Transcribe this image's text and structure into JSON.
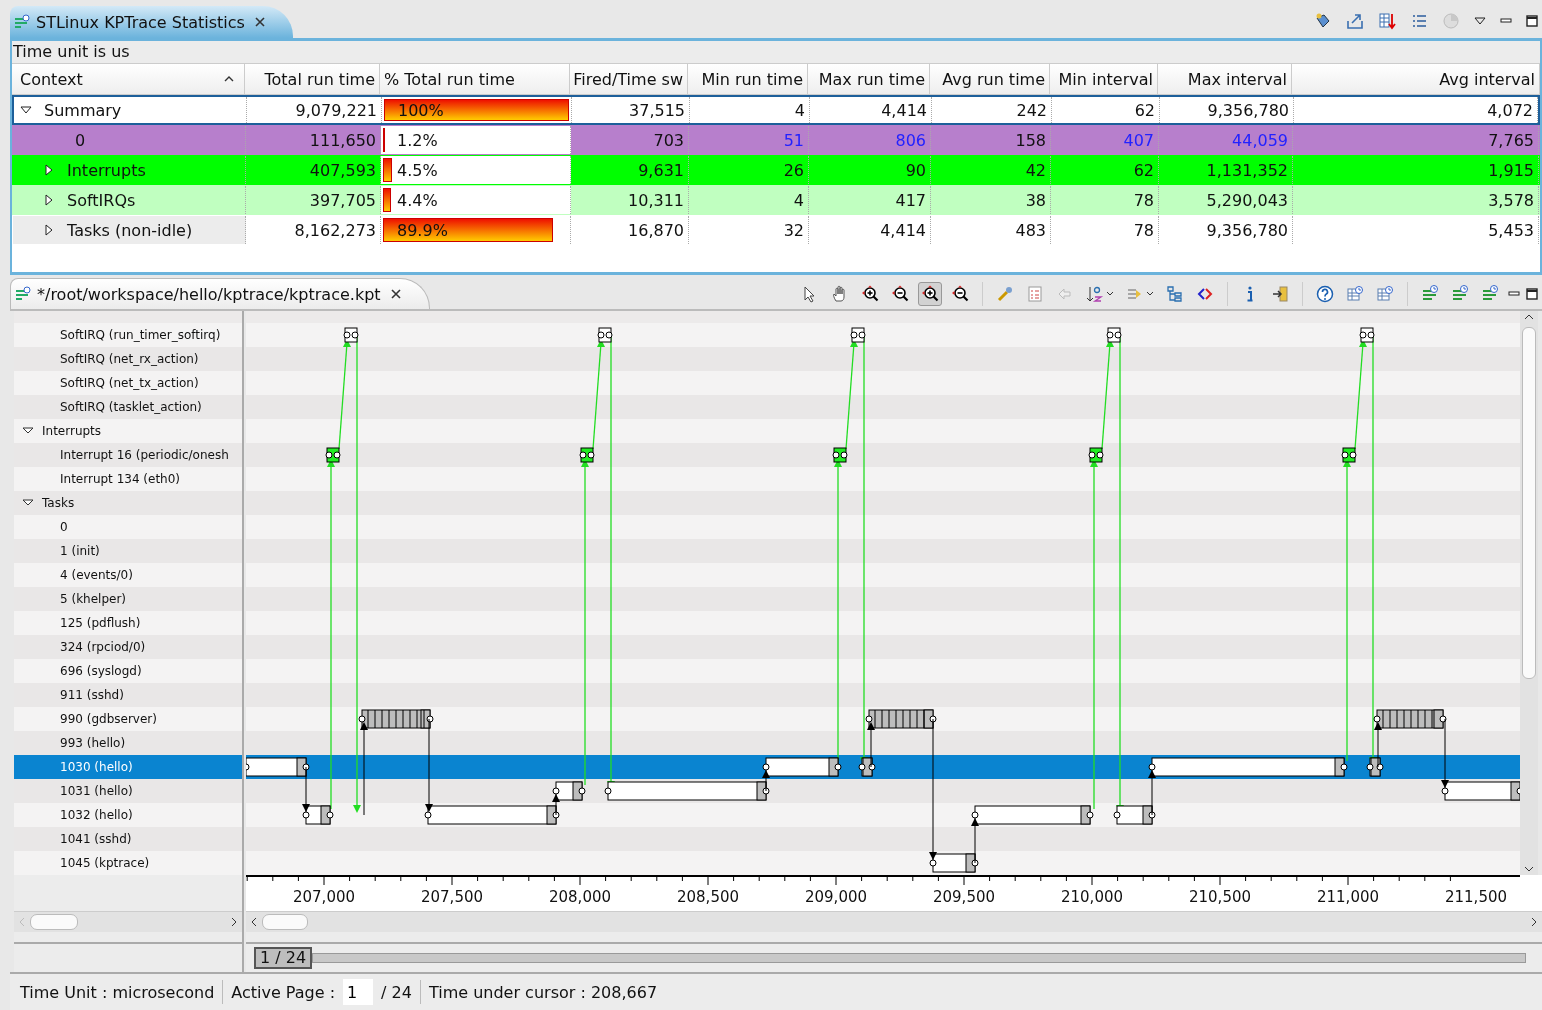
{
  "stats_view": {
    "tab": {
      "title": "STLinux KPTrace Statistics",
      "selected": true
    },
    "info": "Time unit is us",
    "columns": [
      {
        "label": "Context",
        "sorted": true
      },
      {
        "label": "Total run time",
        "sorted": false
      },
      {
        "label": "% Total run time",
        "sorted": false
      },
      {
        "label": "Fired/Time sw",
        "sorted": false
      },
      {
        "label": "Min run time",
        "sorted": false
      },
      {
        "label": "Max run time",
        "sorted": false
      },
      {
        "label": "Avg run time",
        "sorted": false
      },
      {
        "label": "Min interval",
        "sorted": false
      },
      {
        "label": "Max interval",
        "sorted": false
      },
      {
        "label": "Avg interval",
        "sorted": false
      }
    ],
    "rows": [
      {
        "expanded": true,
        "selected": true,
        "color": "#ffffff",
        "cells": [
          {
            "text": "Summary",
            "marked": false
          },
          {
            "text": "9,079,221",
            "marked": false
          },
          {
            "text": "100%",
            "level": 1.0,
            "marked": false
          },
          {
            "text": "37,515",
            "marked": false
          },
          {
            "text": "4",
            "marked": false
          },
          {
            "text": "4,414",
            "marked": false
          },
          {
            "text": "242",
            "marked": false
          },
          {
            "text": "62",
            "marked": false
          },
          {
            "text": "9,356,780",
            "marked": false
          },
          {
            "text": "4,072",
            "marked": false
          }
        ],
        "children": [
          {
            "selected": false,
            "color": "#b77fcc",
            "cells": [
              {
                "text": "0",
                "marked": false
              },
              {
                "text": "111,650",
                "marked": false
              },
              {
                "text": "1.2%",
                "level": 0.012,
                "marked": false
              },
              {
                "text": "703",
                "marked": false
              },
              {
                "text": "51",
                "marked": true
              },
              {
                "text": "806",
                "marked": true
              },
              {
                "text": "158",
                "marked": false
              },
              {
                "text": "407",
                "marked": true
              },
              {
                "text": "44,059",
                "marked": true
              },
              {
                "text": "7,765",
                "marked": false
              }
            ]
          },
          {
            "expanded": false,
            "selected": false,
            "color": "#00ff00",
            "cells": [
              {
                "text": "Interrupts",
                "marked": false
              },
              {
                "text": "407,593",
                "marked": false
              },
              {
                "text": "4.5%",
                "level": 0.045,
                "marked": false
              },
              {
                "text": "9,631",
                "marked": false
              },
              {
                "text": "26",
                "marked": false
              },
              {
                "text": "90",
                "marked": false
              },
              {
                "text": "42",
                "marked": false
              },
              {
                "text": "62",
                "marked": false
              },
              {
                "text": "1,131,352",
                "marked": false
              },
              {
                "text": "1,915",
                "marked": false
              }
            ]
          },
          {
            "expanded": false,
            "selected": false,
            "color": "#c0ffc0",
            "cells": [
              {
                "text": "SoftIRQs",
                "marked": false
              },
              {
                "text": "397,705",
                "marked": false
              },
              {
                "text": "4.4%",
                "level": 0.044,
                "marked": false
              },
              {
                "text": "10,311",
                "marked": false
              },
              {
                "text": "4",
                "marked": false
              },
              {
                "text": "417",
                "marked": false
              },
              {
                "text": "38",
                "marked": false
              },
              {
                "text": "78",
                "marked": false
              },
              {
                "text": "5,290,043",
                "marked": false
              },
              {
                "text": "3,578",
                "marked": false
              }
            ]
          },
          {
            "expanded": false,
            "selected": false,
            "color": "#ffffff",
            "cells": [
              {
                "text": "Tasks (non-idle)",
                "marked": false
              },
              {
                "text": "8,162,273",
                "marked": false
              },
              {
                "text": "89.9%",
                "level": 0.899,
                "marked": false
              },
              {
                "text": "16,870",
                "marked": false
              },
              {
                "text": "32",
                "marked": false
              },
              {
                "text": "4,414",
                "marked": false
              },
              {
                "text": "483",
                "marked": false
              },
              {
                "text": "78",
                "marked": false
              },
              {
                "text": "9,356,780",
                "marked": false
              },
              {
                "text": "5,453",
                "marked": false
              }
            ]
          }
        ]
      }
    ]
  },
  "trace_view": {
    "tab": {
      "title": "*/root/workspace/hello/kptrace/kptrace.kpt",
      "selected": true
    },
    "tools": [
      {
        "selected": false
      },
      {
        "selected": false
      },
      {
        "selected": false
      },
      {
        "selected": false
      },
      {
        "selected": true
      },
      {
        "selected": false
      }
    ],
    "tree": [
      {
        "label": "SoftIRQ (run_timer_softirq)",
        "selected": false
      },
      {
        "label": "SoftIRQ (net_rx_action)",
        "selected": false
      },
      {
        "label": "SoftIRQ (net_tx_action)",
        "selected": false
      },
      {
        "label": "SoftIRQ (tasklet_action)",
        "selected": false
      },
      {
        "label": "Interrupts",
        "expanded": true,
        "selected": false,
        "children": [
          {
            "label": "Interrupt 16 (periodic/onesh",
            "selected": false
          },
          {
            "label": "Interrupt 134 (eth0)",
            "selected": false
          }
        ]
      },
      {
        "label": "Tasks",
        "expanded": true,
        "selected": false,
        "children": [
          {
            "label": "0",
            "selected": false
          },
          {
            "label": "1 (init)",
            "selected": false
          },
          {
            "label": "4 (events/0)",
            "selected": false
          },
          {
            "label": "5 (khelper)",
            "selected": false
          },
          {
            "label": "125 (pdflush)",
            "selected": false
          },
          {
            "label": "324 (rpciod/0)",
            "selected": false
          },
          {
            "label": "696 (syslogd)",
            "selected": false
          },
          {
            "label": "911 (sshd)",
            "selected": false
          },
          {
            "label": "990 (gdbserver)",
            "selected": false
          },
          {
            "label": "993 (hello)",
            "selected": false
          },
          {
            "label": "1030 (hello)",
            "selected": true
          },
          {
            "label": "1031 (hello)",
            "selected": false
          },
          {
            "label": "1032 (hello)",
            "selected": false
          },
          {
            "label": "1041 (sshd)",
            "selected": false
          },
          {
            "label": "1045 (kptrace)",
            "selected": false
          }
        ]
      }
    ],
    "axis_labels": [
      "207,000",
      "207,500",
      "208,000",
      "208,500",
      "209,000",
      "209,500",
      "210,000",
      "210,500",
      "211,000",
      "211,500"
    ],
    "page_indicator": "1 / 24",
    "status": {
      "time_unit": "Time Unit : microsecond",
      "active_page_label": "Active Page :",
      "active_page": "1",
      "page_total": "/ 24",
      "cursor": "Time under cursor : 208,667"
    }
  }
}
